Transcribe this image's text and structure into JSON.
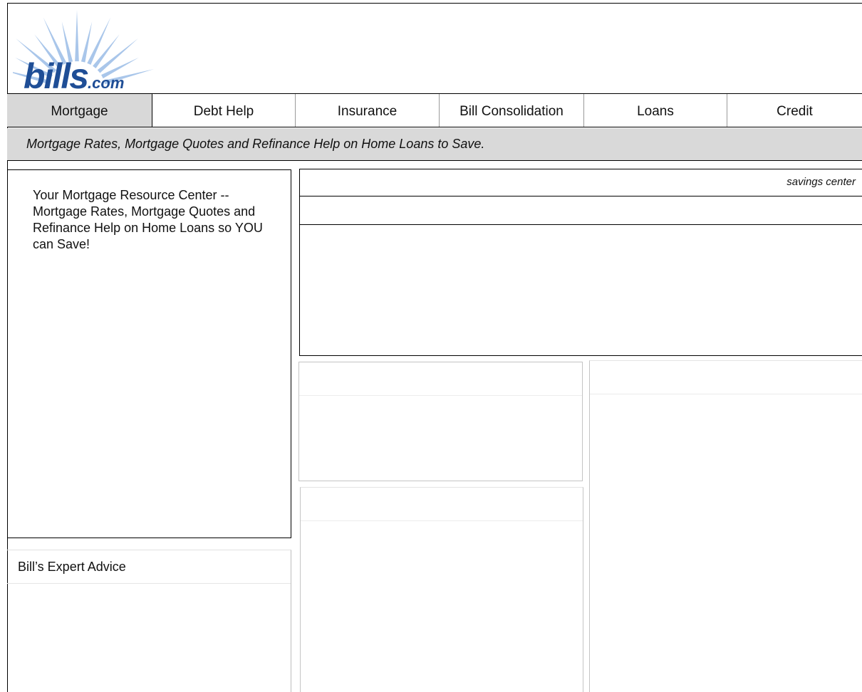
{
  "brand": {
    "logo_main": "bills",
    "logo_suffix": ".com",
    "logo_color": "#1f4e96",
    "rays_color": "#a9c6ea"
  },
  "nav": {
    "items": [
      {
        "label": "Mortgage",
        "active": true
      },
      {
        "label": "Debt Help",
        "active": false
      },
      {
        "label": "Insurance",
        "active": false
      },
      {
        "label": "Bill Consolidation",
        "active": false
      },
      {
        "label": "Loans",
        "active": false
      },
      {
        "label": "Credit",
        "active": false
      }
    ],
    "active_bg": "#d8d8d8"
  },
  "tagline": "Mortgage Rates, Mortgage Quotes and Refinance Help on Home Loans to Save.",
  "left_panel": {
    "text": "Your Mortgage Resource Center -- Mortgage Rates, Mortgage Quotes and Refinance Help on Home Loans so YOU can Save!"
  },
  "advice_panel": {
    "title": "Bill’s Expert Advice"
  },
  "savings_panel": {
    "label": "savings center"
  }
}
